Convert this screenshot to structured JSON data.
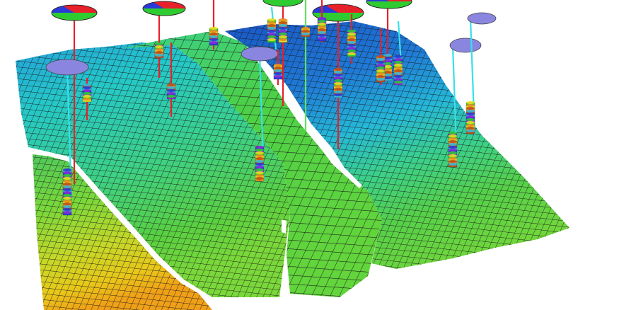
{
  "scene": {
    "kind": "3d-reservoir-model-render",
    "background": "#ffffff",
    "grid_line_color": "#1a1a1a",
    "surface_colormap": [
      "#1060c8",
      "#23a0dc",
      "#25c8c8",
      "#3bd08a",
      "#5ad040",
      "#8ad83a",
      "#c6d828",
      "#e8c81a",
      "#f0a018"
    ],
    "well_stick_colors": {
      "producer": "#e8202a",
      "injector": "#38e0e8",
      "other": "#60e060"
    },
    "well_head_colors": {
      "pie_red": "#e8202a",
      "pie_green": "#2ecc30",
      "pie_blue": "#2a3ad8",
      "disk_lavender": "#8a86e0"
    },
    "log_band_colors": [
      "#2a3ad8",
      "#8a2ad8",
      "#2ecc30",
      "#e8e020",
      "#e89020",
      "#c05018",
      "#38b8d8"
    ],
    "counts": {
      "fault_blocks": 4,
      "wells_with_pie_heads": 6,
      "wells_with_disk_heads": 5
    }
  }
}
